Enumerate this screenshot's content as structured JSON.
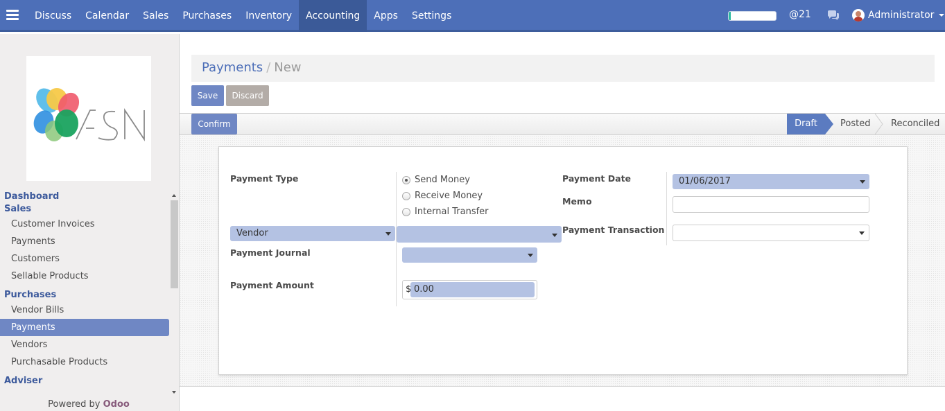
{
  "topbar": {
    "nav": [
      "Discuss",
      "Calendar",
      "Sales",
      "Purchases",
      "Inventory",
      "Accounting",
      "Apps",
      "Settings"
    ],
    "active_index": 5,
    "progress_fraction": 0.05,
    "mentions": "@21",
    "user": "Administrator",
    "colors": {
      "bar": "#4d6fb8",
      "active": "#3b5a98"
    }
  },
  "sidebar": {
    "logo_text": "ASN",
    "sections": [
      {
        "title": "Dashboard",
        "items": []
      },
      {
        "title": "Sales",
        "items": [
          "Customer Invoices",
          "Payments",
          "Customers",
          "Sellable Products"
        ]
      },
      {
        "title": "Purchases",
        "items": [
          "Vendor Bills",
          "Payments",
          "Vendors",
          "Purchasable Products"
        ]
      },
      {
        "title": "Adviser",
        "items": []
      }
    ],
    "active_item": "Purchases/Payments",
    "powered_prefix": "Powered by",
    "powered_brand": "Odoo"
  },
  "breadcrumb": {
    "parent": "Payments",
    "separator": "/",
    "current": "New"
  },
  "buttons": {
    "save": "Save",
    "discard": "Discard",
    "confirm": "Confirm"
  },
  "status_stages": [
    "Draft",
    "Posted",
    "Reconciled"
  ],
  "status_current": "Draft",
  "form": {
    "payment_type_label": "Payment Type",
    "payment_type_options": [
      "Send Money",
      "Receive Money",
      "Internal Transfer"
    ],
    "payment_type_selected": "Send Money",
    "partner_type": "Vendor",
    "partner_value": "",
    "payment_journal_label": "Payment Journal",
    "payment_journal_value": "",
    "payment_amount_label": "Payment Amount",
    "currency_symbol": "$",
    "payment_amount_value": "0.00",
    "payment_date_label": "Payment Date",
    "payment_date_value": "01/06/2017",
    "memo_label": "Memo",
    "memo_value": "",
    "payment_transaction_label": "Payment Transaction",
    "payment_transaction_value": ""
  }
}
